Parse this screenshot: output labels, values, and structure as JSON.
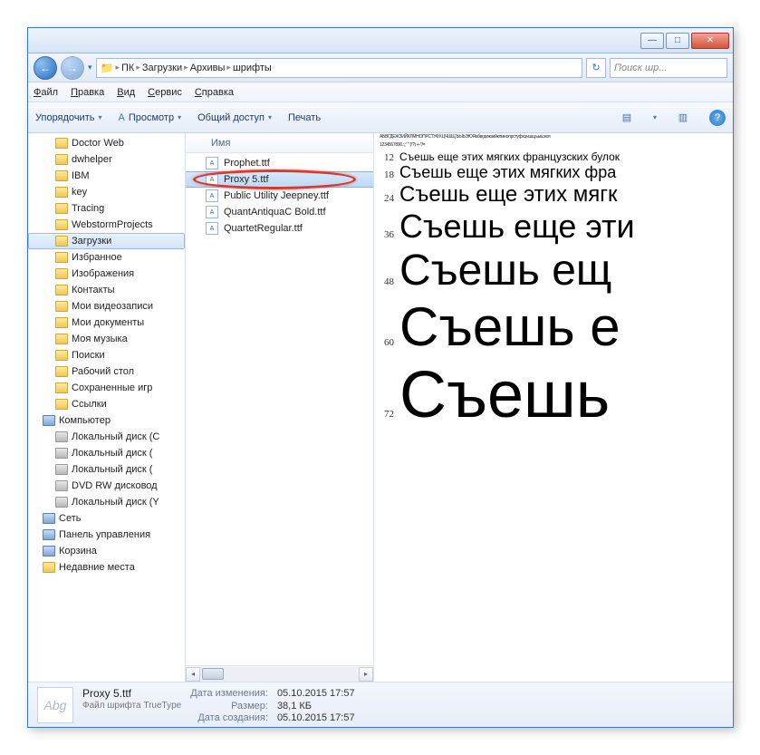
{
  "titlebar": {
    "min": "—",
    "max": "□",
    "close": "✕"
  },
  "nav": {
    "back": "←",
    "fwd": "→",
    "crumbs": [
      "ПК",
      "Загрузки",
      "Архивы",
      "шрифты"
    ],
    "sep": "▸",
    "refresh": "↻",
    "search_placeholder": "Поиск шр..."
  },
  "menu": [
    "Файл",
    "Правка",
    "Вид",
    "Сервис",
    "Справка"
  ],
  "toolbar": {
    "organize": "Упорядочить",
    "preview": "Просмотр",
    "share": "Общий доступ",
    "print": "Печать",
    "drop": "▾",
    "views": "▤",
    "pane": "▥",
    "help": "?"
  },
  "tree": [
    {
      "label": "Doctor Web",
      "icon": "folder",
      "lvl": 1
    },
    {
      "label": "dwhelper",
      "icon": "folder",
      "lvl": 1
    },
    {
      "label": "IBM",
      "icon": "folder",
      "lvl": 1
    },
    {
      "label": "key",
      "icon": "folder",
      "lvl": 1
    },
    {
      "label": "Tracing",
      "icon": "folder",
      "lvl": 1
    },
    {
      "label": "WebstormProjects",
      "icon": "folder",
      "lvl": 1
    },
    {
      "label": "Загрузки",
      "icon": "folder",
      "lvl": 1,
      "sel": true
    },
    {
      "label": "Избранное",
      "icon": "folder",
      "lvl": 1
    },
    {
      "label": "Изображения",
      "icon": "folder",
      "lvl": 1
    },
    {
      "label": "Контакты",
      "icon": "folder",
      "lvl": 1
    },
    {
      "label": "Мои видеозаписи",
      "icon": "folder",
      "lvl": 1
    },
    {
      "label": "Мои документы",
      "icon": "folder",
      "lvl": 1
    },
    {
      "label": "Моя музыка",
      "icon": "folder",
      "lvl": 1
    },
    {
      "label": "Поиски",
      "icon": "folder",
      "lvl": 1
    },
    {
      "label": "Рабочий стол",
      "icon": "folder",
      "lvl": 1
    },
    {
      "label": "Сохраненные игр",
      "icon": "folder",
      "lvl": 1
    },
    {
      "label": "Ссылки",
      "icon": "folder",
      "lvl": 1
    },
    {
      "label": "Компьютер",
      "icon": "comp",
      "lvl": 0
    },
    {
      "label": "Локальный диск (C",
      "icon": "drive",
      "lvl": 1
    },
    {
      "label": "Локальный диск (",
      "icon": "drive",
      "lvl": 1
    },
    {
      "label": "Локальный диск (",
      "icon": "drive",
      "lvl": 1
    },
    {
      "label": "DVD RW дисковод",
      "icon": "drive",
      "lvl": 1
    },
    {
      "label": "Локальный диск (Y",
      "icon": "drive",
      "lvl": 1
    },
    {
      "label": "Сеть",
      "icon": "comp",
      "lvl": 0
    },
    {
      "label": "Панель управления",
      "icon": "comp",
      "lvl": 0
    },
    {
      "label": "Корзина",
      "icon": "comp",
      "lvl": 0
    },
    {
      "label": "Недавние места",
      "icon": "folder",
      "lvl": 0
    }
  ],
  "list": {
    "header": "Имя",
    "files": [
      {
        "name": "Prophet.ttf"
      },
      {
        "name": "Proxy 5.ttf",
        "sel": true
      },
      {
        "name": "Public Utility Jeepney.ttf"
      },
      {
        "name": "QuantAntiquaC Bold.ttf"
      },
      {
        "name": "QuartetRegular.ttf"
      }
    ],
    "font_badge": "A",
    "scroll_left": "◂",
    "scroll_right": "▸"
  },
  "preview": {
    "header_tiny1": "АБВГДЕЖЗИЙКЛМНОПРСТУФХЦЧШЩЪЫЬЭЮЯабвгдежзийклмнопрстуфхцчшщъыьэюя",
    "header_tiny2": "1234567890.:,;' \" (!?) +-*/=",
    "samples": [
      {
        "size": "12",
        "text": "Съешь еще этих мягких французских булок"
      },
      {
        "size": "18",
        "text": "Съешь еще этих мягких фра"
      },
      {
        "size": "24",
        "text": "Съешь еще этих мягк"
      },
      {
        "size": "36",
        "text": "Съешь еще эти"
      },
      {
        "size": "48",
        "text": "Съешь ещ"
      },
      {
        "size": "60",
        "text": "Съешь е"
      },
      {
        "size": "72",
        "text": "Съешь"
      }
    ]
  },
  "status": {
    "thumb": "Abg",
    "filename": "Proxy 5.ttf",
    "filetype": "Файл шрифта TrueType",
    "modified_lbl": "Дата изменения:",
    "modified_val": "05.10.2015 17:57",
    "size_lbl": "Размер:",
    "size_val": "38,1 КБ",
    "created_lbl": "Дата создания:",
    "created_val": "05.10.2015 17:57"
  }
}
